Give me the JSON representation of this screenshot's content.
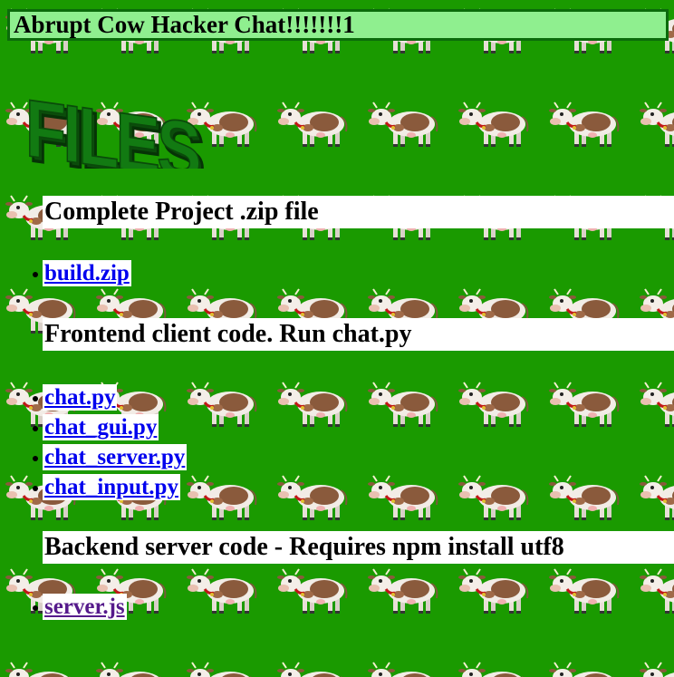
{
  "page": {
    "title": "Abrupt Cow Hacker Chat!!!!!!!1",
    "background_color": "#1a9a00",
    "title_bar_bg": "#8fef8f",
    "title_bar_border": "#0b6b0b",
    "logo_icon": "files-wordart-logo",
    "background_icon": "cow-icon"
  },
  "sections": [
    {
      "heading": "Complete Project .zip file",
      "files": [
        {
          "label": "build.zip",
          "visited": false
        }
      ]
    },
    {
      "heading": "Frontend client code. Run chat.py",
      "files": [
        {
          "label": "chat.py",
          "visited": false
        },
        {
          "label": "chat_gui.py",
          "visited": false
        },
        {
          "label": "chat_server.py",
          "visited": false
        },
        {
          "label": "chat_input.py",
          "visited": false
        }
      ]
    },
    {
      "heading": "Backend server code - Requires npm install utf8",
      "files": [
        {
          "label": "server.js",
          "visited": true
        }
      ]
    }
  ],
  "colors": {
    "link": "#0000ee",
    "link_visited": "#551a8b",
    "heading_bg": "#ffffff"
  }
}
